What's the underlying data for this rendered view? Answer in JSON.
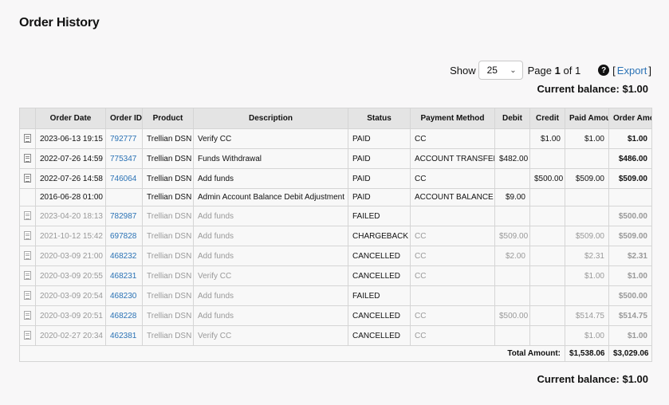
{
  "page": {
    "title": "Order History"
  },
  "controls": {
    "show_label": "Show",
    "per_page": "25",
    "page_prefix": "Page",
    "page_current": "1",
    "page_of": "of 1",
    "help": "?",
    "export_label": "Export",
    "bracket_open": "[",
    "bracket_close": "]"
  },
  "balance": {
    "top": "Current balance: $1.00",
    "bottom": "Current balance: $1.00"
  },
  "table": {
    "headers": [
      "",
      "Order Date",
      "Order ID",
      "Product",
      "Description",
      "Status",
      "Payment Method",
      "Debit",
      "Credit",
      "Paid Amount",
      "Order Amount"
    ],
    "rows": [
      {
        "icon": true,
        "dim": false,
        "date": "2023-06-13 19:15",
        "id": "792777",
        "product": "Trellian DSN",
        "description": "Verify CC",
        "status": "PAID",
        "method": "CC",
        "debit": "",
        "credit": "$1.00",
        "paid": "$1.00",
        "amount": "$1.00"
      },
      {
        "icon": true,
        "dim": false,
        "date": "2022-07-26 14:59",
        "id": "775347",
        "product": "Trellian DSN",
        "description": "Funds Withdrawal",
        "status": "PAID",
        "method": "ACCOUNT TRANSFER",
        "debit": "$482.00",
        "credit": "",
        "paid": "",
        "amount": "$486.00"
      },
      {
        "icon": true,
        "dim": false,
        "date": "2022-07-26 14:58",
        "id": "746064",
        "product": "Trellian DSN",
        "description": "Add funds",
        "status": "PAID",
        "method": "CC",
        "debit": "",
        "credit": "$500.00",
        "paid": "$509.00",
        "amount": "$509.00"
      },
      {
        "icon": false,
        "dim": false,
        "date": "2016-06-28 01:00",
        "id": "",
        "product": "Trellian DSN",
        "description": "Admin Account Balance Debit Adjustment",
        "status": "PAID",
        "method": "ACCOUNT BALANCE",
        "debit": "$9.00",
        "credit": "",
        "paid": "",
        "amount": ""
      },
      {
        "icon": true,
        "dim": true,
        "date": "2023-04-20 18:13",
        "id": "782987",
        "product": "Trellian DSN",
        "description": "Add funds",
        "status": "FAILED",
        "method": "",
        "debit": "",
        "credit": "",
        "paid": "",
        "amount": "$500.00"
      },
      {
        "icon": true,
        "dim": true,
        "date": "2021-10-12 15:42",
        "id": "697828",
        "product": "Trellian DSN",
        "description": "Add funds",
        "status": "CHARGEBACK",
        "method": "CC",
        "debit": "$509.00",
        "credit": "",
        "paid": "$509.00",
        "amount": "$509.00"
      },
      {
        "icon": true,
        "dim": true,
        "date": "2020-03-09 21:00",
        "id": "468232",
        "product": "Trellian DSN",
        "description": "Add funds",
        "status": "CANCELLED",
        "method": "CC",
        "debit": "$2.00",
        "credit": "",
        "paid": "$2.31",
        "amount": "$2.31"
      },
      {
        "icon": true,
        "dim": true,
        "date": "2020-03-09 20:55",
        "id": "468231",
        "product": "Trellian DSN",
        "description": "Verify CC",
        "status": "CANCELLED",
        "method": "CC",
        "debit": "",
        "credit": "",
        "paid": "$1.00",
        "amount": "$1.00"
      },
      {
        "icon": true,
        "dim": true,
        "date": "2020-03-09 20:54",
        "id": "468230",
        "product": "Trellian DSN",
        "description": "Add funds",
        "status": "FAILED",
        "method": "",
        "debit": "",
        "credit": "",
        "paid": "",
        "amount": "$500.00"
      },
      {
        "icon": true,
        "dim": true,
        "date": "2020-03-09 20:51",
        "id": "468228",
        "product": "Trellian DSN",
        "description": "Add funds",
        "status": "CANCELLED",
        "method": "CC",
        "debit": "$500.00",
        "credit": "",
        "paid": "$514.75",
        "amount": "$514.75"
      },
      {
        "icon": true,
        "dim": true,
        "date": "2020-02-27 20:34",
        "id": "462381",
        "product": "Trellian DSN",
        "description": "Verify CC",
        "status": "CANCELLED",
        "method": "CC",
        "debit": "",
        "credit": "",
        "paid": "$1.00",
        "amount": "$1.00"
      }
    ],
    "total": {
      "label": "Total Amount:",
      "paid": "$1,538.06",
      "amount": "$3,029.06"
    }
  },
  "colors": {
    "link": "#2a72b5",
    "header_bg": "#e4e4e4",
    "dim_text": "#999999",
    "page_bg": "#f8f7f8"
  }
}
